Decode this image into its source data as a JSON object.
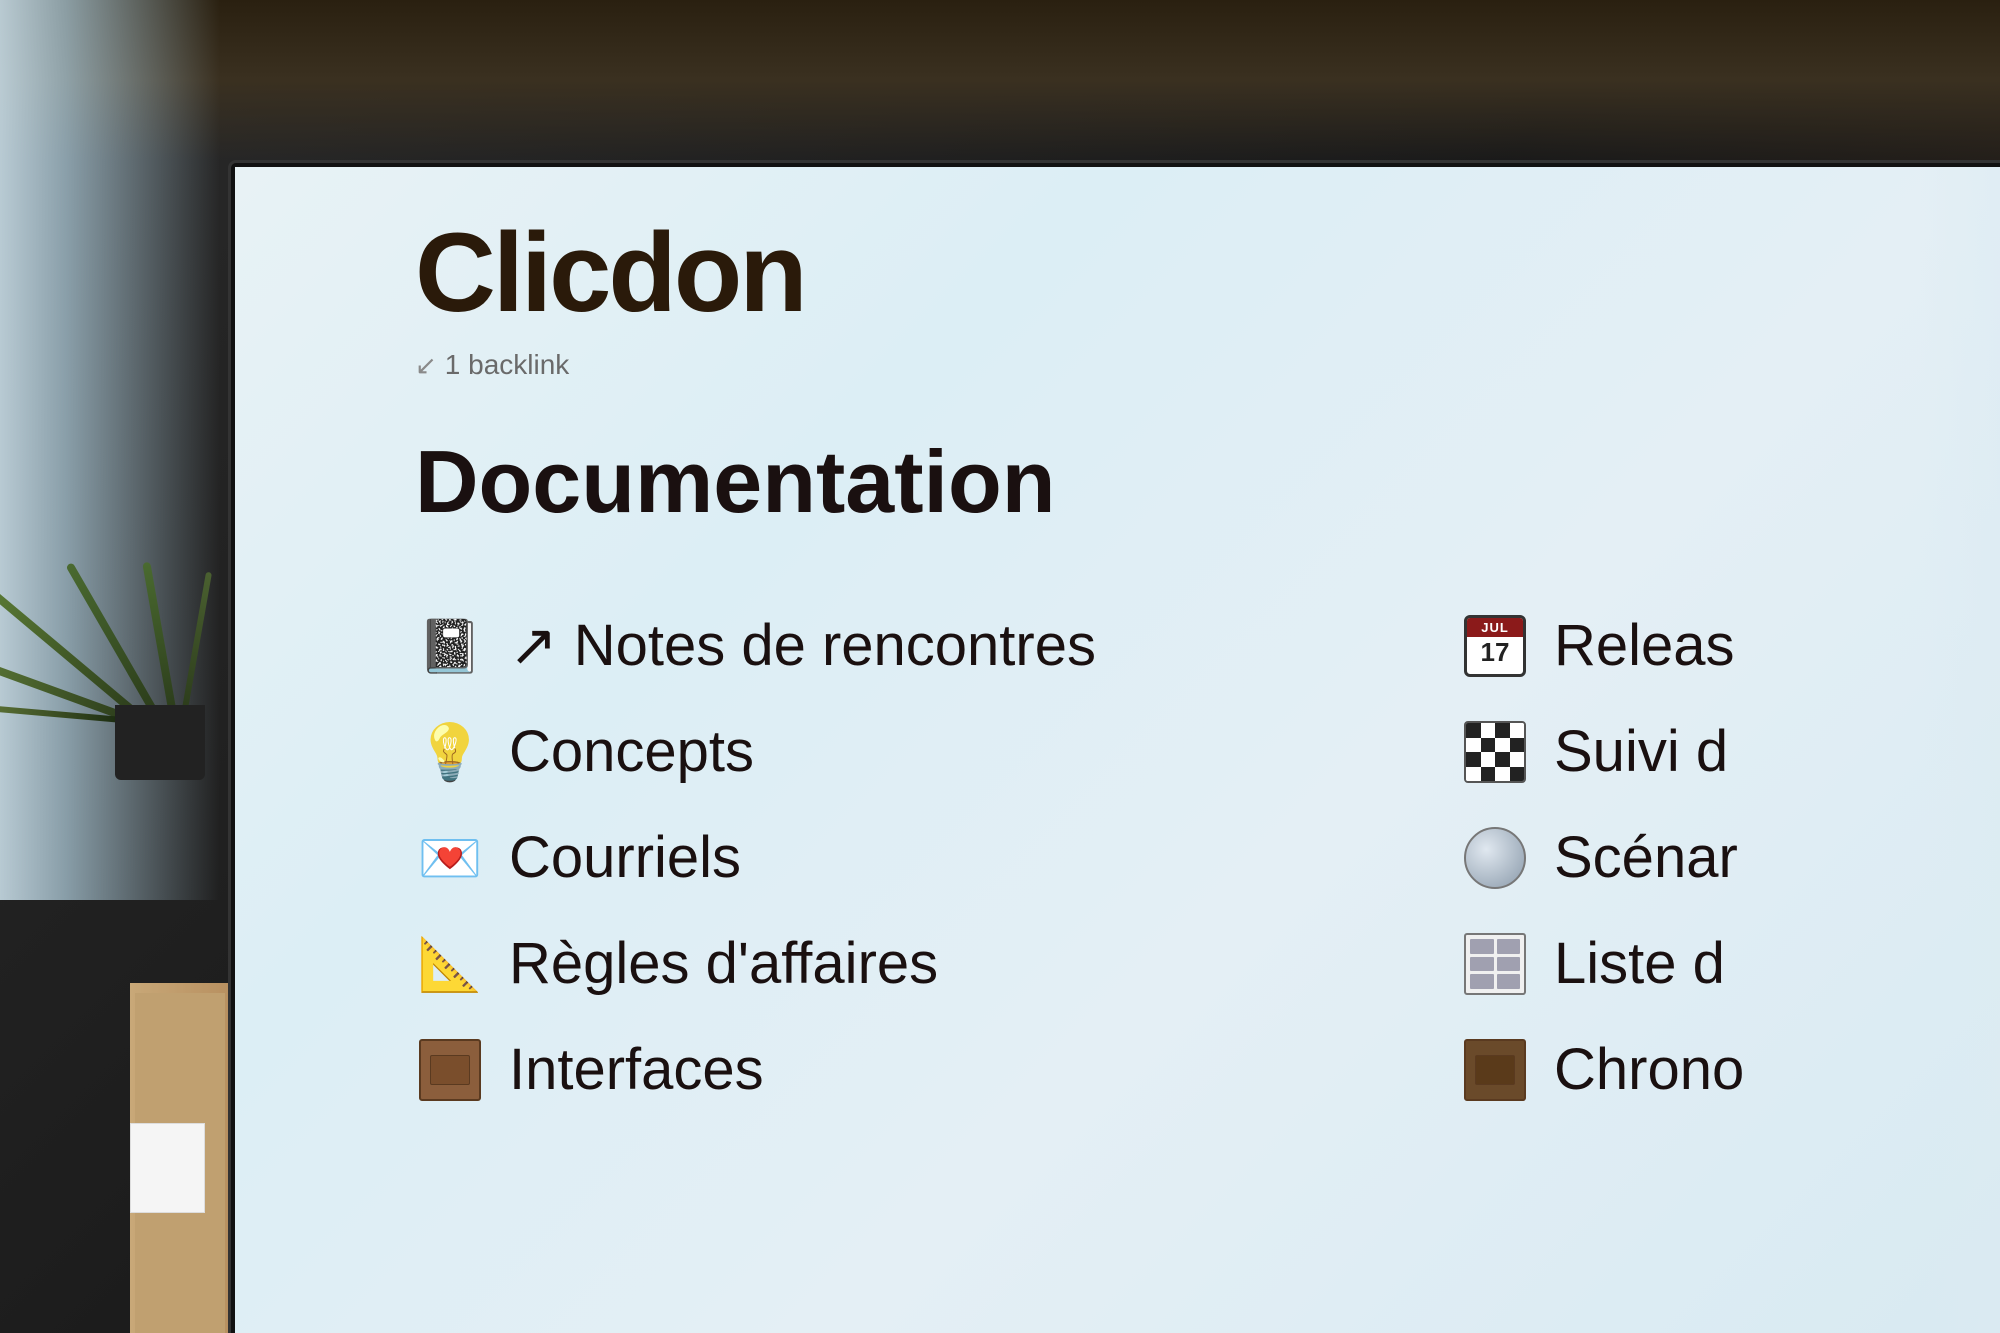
{
  "page": {
    "title": "Clicdon",
    "backlink": {
      "icon": "↙",
      "count": "1",
      "label": "backlink",
      "full_text": "1 backlink"
    },
    "section_heading": "Documentation",
    "doc_items": [
      {
        "id": "notes-rencontres",
        "icon": "📓",
        "icon_label": "notebook-with-arrow-icon",
        "label": "↗ Notes de rencontres"
      },
      {
        "id": "concepts",
        "icon": "💡",
        "icon_label": "lightbulb-icon",
        "label": "Concepts"
      },
      {
        "id": "courriels",
        "icon": "❤️",
        "icon_label": "heart-envelope-icon",
        "label": "Courriels"
      },
      {
        "id": "regles-affaires",
        "icon": "📐",
        "icon_label": "triangle-ruler-icon",
        "label": "Règles d'affaires"
      },
      {
        "id": "interfaces",
        "icon": "📦",
        "icon_label": "box-icon",
        "label": "Interfaces"
      }
    ],
    "right_items": [
      {
        "id": "releases",
        "icon": "calendar",
        "icon_label": "calendar-icon",
        "month": "JUL",
        "date": "17",
        "label": "Releas"
      },
      {
        "id": "suivi",
        "icon": "checker",
        "icon_label": "checkerboard-icon",
        "label": "Suivi d"
      },
      {
        "id": "scenarios",
        "icon": "sphere",
        "icon_label": "sphere-icon",
        "label": "Scénar"
      },
      {
        "id": "liste",
        "icon": "brick",
        "icon_label": "brick-icon",
        "label": "Liste d"
      },
      {
        "id": "chrono",
        "icon": "box",
        "icon_label": "box-icon",
        "label": "Chrono"
      }
    ]
  },
  "colors": {
    "bg_screen": "#e4eff5",
    "text_primary": "#1a1010",
    "text_secondary": "#6a6a6a",
    "accent": "#2a1a0a"
  }
}
